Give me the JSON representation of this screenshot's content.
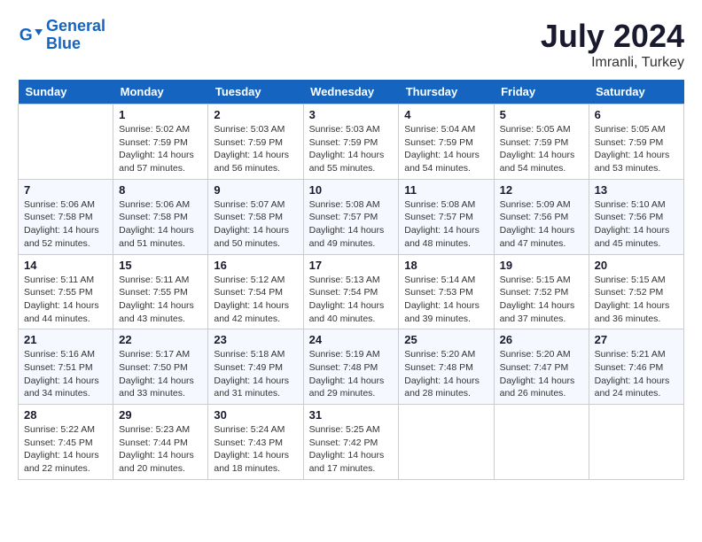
{
  "header": {
    "logo_line1": "General",
    "logo_line2": "Blue",
    "title": "July 2024",
    "subtitle": "Imranli, Turkey"
  },
  "days": [
    "Sunday",
    "Monday",
    "Tuesday",
    "Wednesday",
    "Thursday",
    "Friday",
    "Saturday"
  ],
  "weeks": [
    [
      {
        "date": "",
        "info": ""
      },
      {
        "date": "1",
        "info": "Sunrise: 5:02 AM\nSunset: 7:59 PM\nDaylight: 14 hours\nand 57 minutes."
      },
      {
        "date": "2",
        "info": "Sunrise: 5:03 AM\nSunset: 7:59 PM\nDaylight: 14 hours\nand 56 minutes."
      },
      {
        "date": "3",
        "info": "Sunrise: 5:03 AM\nSunset: 7:59 PM\nDaylight: 14 hours\nand 55 minutes."
      },
      {
        "date": "4",
        "info": "Sunrise: 5:04 AM\nSunset: 7:59 PM\nDaylight: 14 hours\nand 54 minutes."
      },
      {
        "date": "5",
        "info": "Sunrise: 5:05 AM\nSunset: 7:59 PM\nDaylight: 14 hours\nand 54 minutes."
      },
      {
        "date": "6",
        "info": "Sunrise: 5:05 AM\nSunset: 7:59 PM\nDaylight: 14 hours\nand 53 minutes."
      }
    ],
    [
      {
        "date": "7",
        "info": "Sunrise: 5:06 AM\nSunset: 7:58 PM\nDaylight: 14 hours\nand 52 minutes."
      },
      {
        "date": "8",
        "info": "Sunrise: 5:06 AM\nSunset: 7:58 PM\nDaylight: 14 hours\nand 51 minutes."
      },
      {
        "date": "9",
        "info": "Sunrise: 5:07 AM\nSunset: 7:58 PM\nDaylight: 14 hours\nand 50 minutes."
      },
      {
        "date": "10",
        "info": "Sunrise: 5:08 AM\nSunset: 7:57 PM\nDaylight: 14 hours\nand 49 minutes."
      },
      {
        "date": "11",
        "info": "Sunrise: 5:08 AM\nSunset: 7:57 PM\nDaylight: 14 hours\nand 48 minutes."
      },
      {
        "date": "12",
        "info": "Sunrise: 5:09 AM\nSunset: 7:56 PM\nDaylight: 14 hours\nand 47 minutes."
      },
      {
        "date": "13",
        "info": "Sunrise: 5:10 AM\nSunset: 7:56 PM\nDaylight: 14 hours\nand 45 minutes."
      }
    ],
    [
      {
        "date": "14",
        "info": "Sunrise: 5:11 AM\nSunset: 7:55 PM\nDaylight: 14 hours\nand 44 minutes."
      },
      {
        "date": "15",
        "info": "Sunrise: 5:11 AM\nSunset: 7:55 PM\nDaylight: 14 hours\nand 43 minutes."
      },
      {
        "date": "16",
        "info": "Sunrise: 5:12 AM\nSunset: 7:54 PM\nDaylight: 14 hours\nand 42 minutes."
      },
      {
        "date": "17",
        "info": "Sunrise: 5:13 AM\nSunset: 7:54 PM\nDaylight: 14 hours\nand 40 minutes."
      },
      {
        "date": "18",
        "info": "Sunrise: 5:14 AM\nSunset: 7:53 PM\nDaylight: 14 hours\nand 39 minutes."
      },
      {
        "date": "19",
        "info": "Sunrise: 5:15 AM\nSunset: 7:52 PM\nDaylight: 14 hours\nand 37 minutes."
      },
      {
        "date": "20",
        "info": "Sunrise: 5:15 AM\nSunset: 7:52 PM\nDaylight: 14 hours\nand 36 minutes."
      }
    ],
    [
      {
        "date": "21",
        "info": "Sunrise: 5:16 AM\nSunset: 7:51 PM\nDaylight: 14 hours\nand 34 minutes."
      },
      {
        "date": "22",
        "info": "Sunrise: 5:17 AM\nSunset: 7:50 PM\nDaylight: 14 hours\nand 33 minutes."
      },
      {
        "date": "23",
        "info": "Sunrise: 5:18 AM\nSunset: 7:49 PM\nDaylight: 14 hours\nand 31 minutes."
      },
      {
        "date": "24",
        "info": "Sunrise: 5:19 AM\nSunset: 7:48 PM\nDaylight: 14 hours\nand 29 minutes."
      },
      {
        "date": "25",
        "info": "Sunrise: 5:20 AM\nSunset: 7:48 PM\nDaylight: 14 hours\nand 28 minutes."
      },
      {
        "date": "26",
        "info": "Sunrise: 5:20 AM\nSunset: 7:47 PM\nDaylight: 14 hours\nand 26 minutes."
      },
      {
        "date": "27",
        "info": "Sunrise: 5:21 AM\nSunset: 7:46 PM\nDaylight: 14 hours\nand 24 minutes."
      }
    ],
    [
      {
        "date": "28",
        "info": "Sunrise: 5:22 AM\nSunset: 7:45 PM\nDaylight: 14 hours\nand 22 minutes."
      },
      {
        "date": "29",
        "info": "Sunrise: 5:23 AM\nSunset: 7:44 PM\nDaylight: 14 hours\nand 20 minutes."
      },
      {
        "date": "30",
        "info": "Sunrise: 5:24 AM\nSunset: 7:43 PM\nDaylight: 14 hours\nand 18 minutes."
      },
      {
        "date": "31",
        "info": "Sunrise: 5:25 AM\nSunset: 7:42 PM\nDaylight: 14 hours\nand 17 minutes."
      },
      {
        "date": "",
        "info": ""
      },
      {
        "date": "",
        "info": ""
      },
      {
        "date": "",
        "info": ""
      }
    ]
  ]
}
